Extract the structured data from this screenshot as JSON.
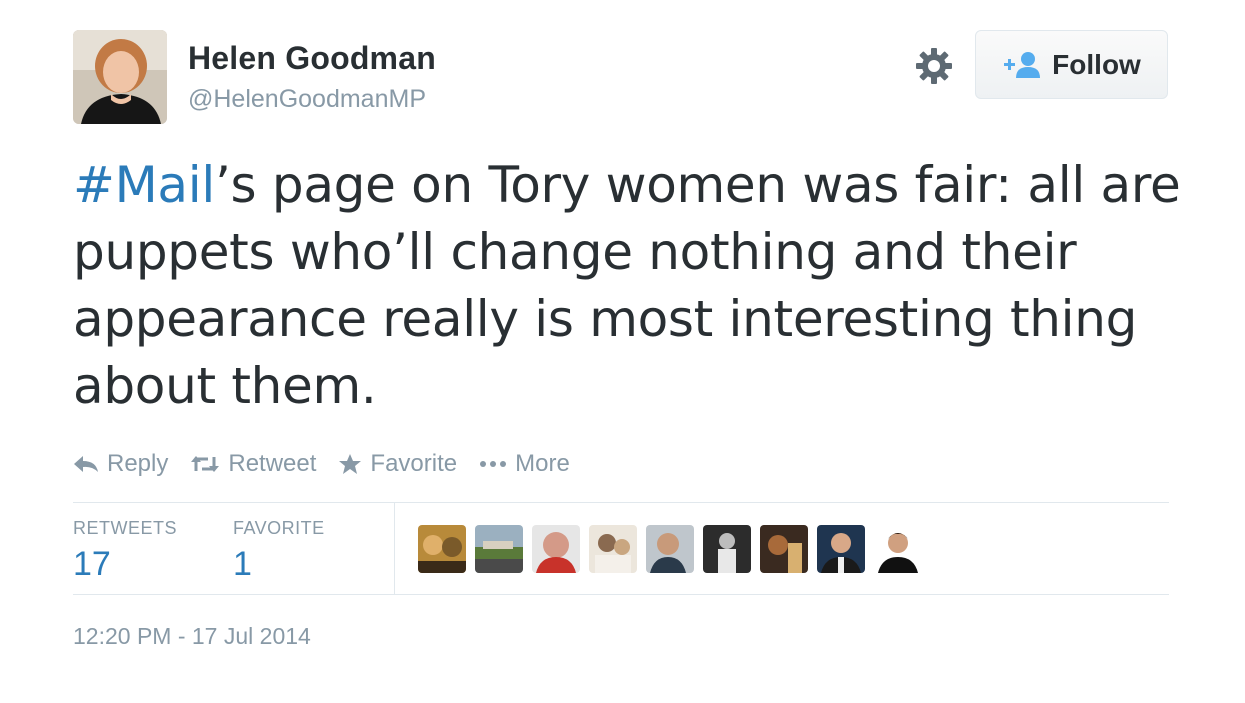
{
  "author": {
    "name": "Helen Goodman",
    "handle": "@HelenGoodmanMP"
  },
  "header": {
    "follow_label": "Follow",
    "settings_icon": "gear-icon",
    "follow_icon": "add-user-icon"
  },
  "tweet": {
    "hashtag": "#Mail",
    "text": "’s page on Tory women was fair: all are puppets who’ll change nothing and their appearance really is most interesting thing about them."
  },
  "actions": [
    {
      "label": "Reply",
      "icon": "reply-icon"
    },
    {
      "label": "Retweet",
      "icon": "retweet-icon"
    },
    {
      "label": "Favorite",
      "icon": "star-icon"
    },
    {
      "label": "More",
      "icon": "more-icon"
    }
  ],
  "stats": {
    "retweets_label": "RETWEETS",
    "retweets_count": "17",
    "favorites_label": "FAVORITE",
    "favorites_count": "1"
  },
  "timestamp": "12:20 PM - 17 Jul 2014",
  "colors": {
    "link": "#2b7bb9",
    "text": "#292f33",
    "muted": "#8899a6",
    "border": "#e1e8ed"
  }
}
